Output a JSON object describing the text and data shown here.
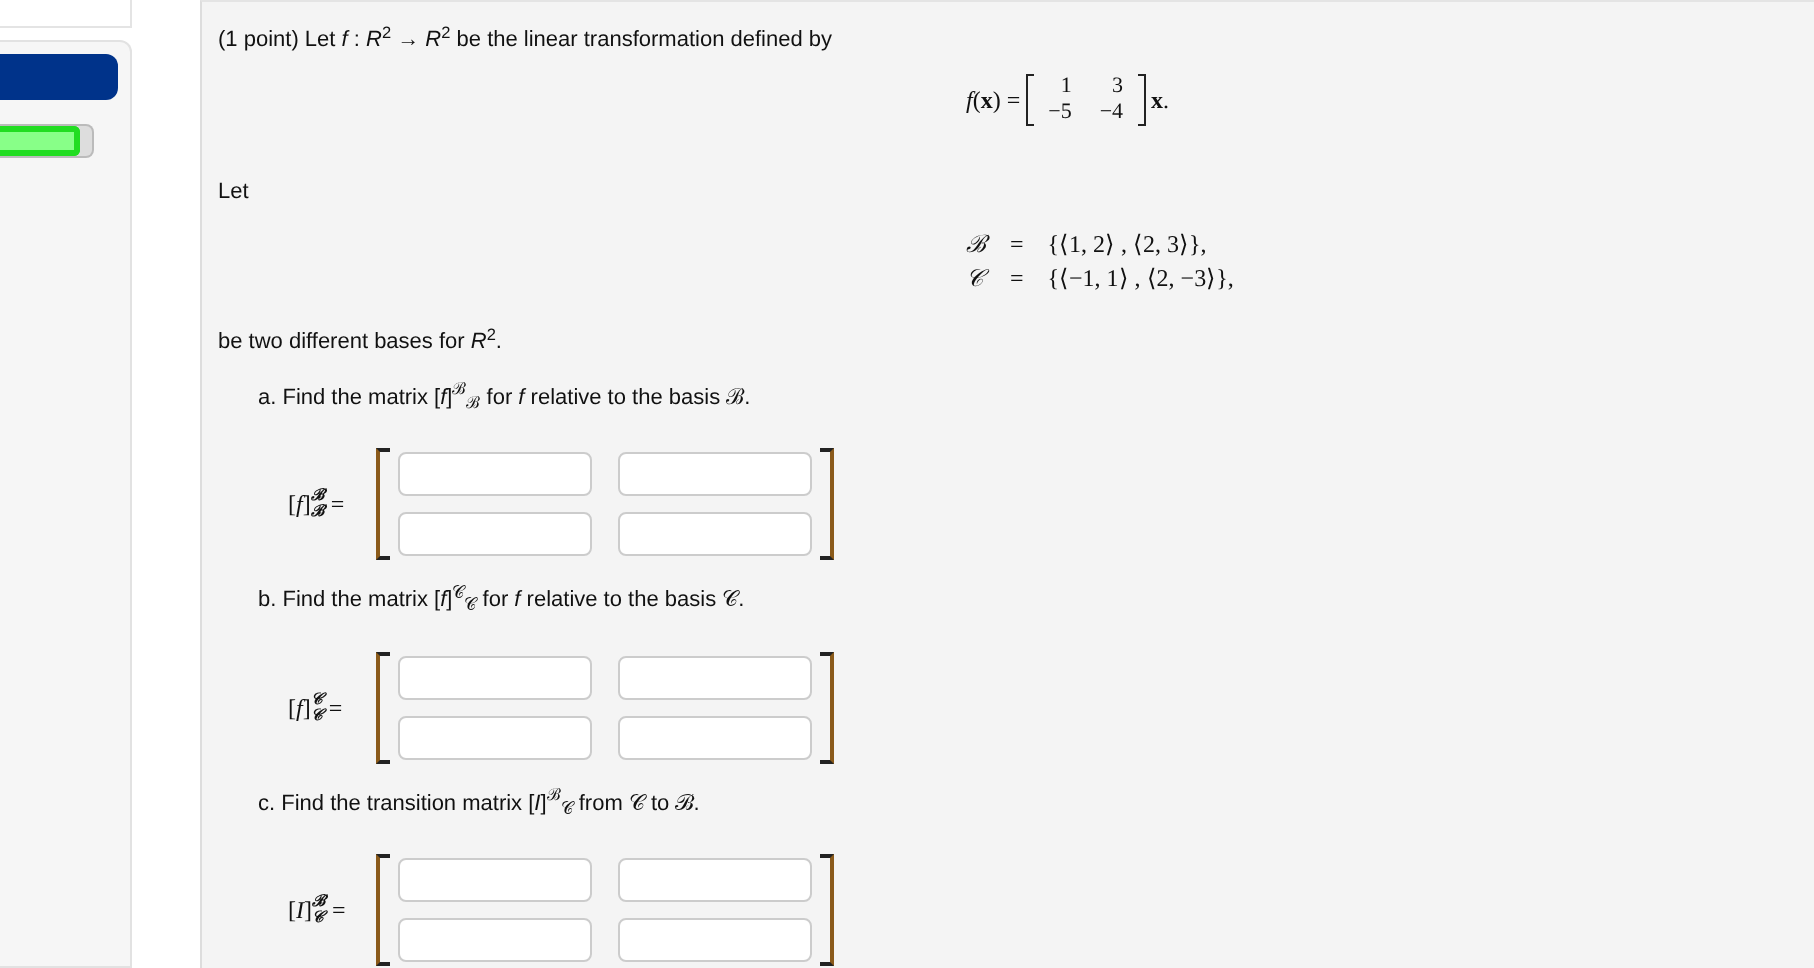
{
  "sidebar": {
    "progress": {
      "level": 0.88
    }
  },
  "problem": {
    "intro": "(1 point) Let *f* : *R*$^{2}$ → *R*$^{2}$ be the linear transformation defined by",
    "formula": {
      "lhs": "*f*(**x**) =",
      "matrix": [
        [
          "1",
          "3"
        ],
        [
          "−5",
          "−4"
        ]
      ],
      "rhs": "**x**."
    },
    "let": "Let",
    "bases": [
      {
        "symbol": "ℬ",
        "eq": "=",
        "set": "{⟨1, 2⟩ , ⟨2, 3⟩},"
      },
      {
        "symbol": "𝒞",
        "eq": "=",
        "set": "{⟨−1, 1⟩ , ⟨2, −3⟩},"
      }
    ],
    "bases_text": "be two different bases for *R*$^{2}$.",
    "parts": [
      {
        "prompt": "a. Find the matrix [*f*]$^{ℬ}$$_{ℬ}$ for *f* relative to the basis ℬ.",
        "label": {
          "base": "[*f*]",
          "sup": "ℬ",
          "sub": "ℬ",
          "eq": "="
        }
      },
      {
        "prompt": "b. Find the matrix [*f*]$^{𝒞}$$_{𝒞}$ for *f* relative to the basis 𝒞.",
        "label": {
          "base": "[*f*]",
          "sup": "𝒞",
          "sub": "𝒞",
          "eq": "="
        }
      },
      {
        "prompt": "c. Find the transition matrix [*I*]$^{ℬ}$$_{𝒞}$ from 𝒞 to ℬ.",
        "label": {
          "base": "[*I*]",
          "sup": "ℬ",
          "sub": "𝒞",
          "eq": "="
        }
      }
    ]
  }
}
